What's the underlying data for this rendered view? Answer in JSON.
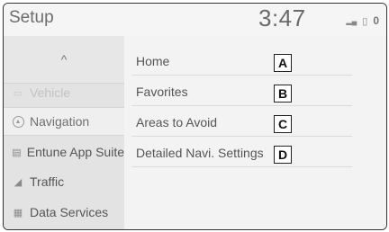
{
  "header": {
    "title": "Setup",
    "clock": "3:47",
    "status": {
      "signal_icon": "signal-bars-icon",
      "battery_icon": "phone-battery-icon",
      "count": "0"
    }
  },
  "sidebar": {
    "up_icon": "chevron-up-icon",
    "up_glyph": "^",
    "items": [
      {
        "label": "Vehicle",
        "icon": "car-icon"
      },
      {
        "label": "Navigation",
        "icon": "navigation-icon"
      },
      {
        "label": "Entune App Suite",
        "icon": "app-suite-icon"
      },
      {
        "label": "Traffic",
        "icon": "traffic-icon"
      },
      {
        "label": "Data Services",
        "icon": "data-services-icon"
      }
    ]
  },
  "menu": {
    "items": [
      {
        "label": "Home",
        "callout": "A"
      },
      {
        "label": "Favorites",
        "callout": "B"
      },
      {
        "label": "Areas to Avoid",
        "callout": "C"
      },
      {
        "label": "Detailed Navi. Settings",
        "callout": "D"
      }
    ]
  }
}
